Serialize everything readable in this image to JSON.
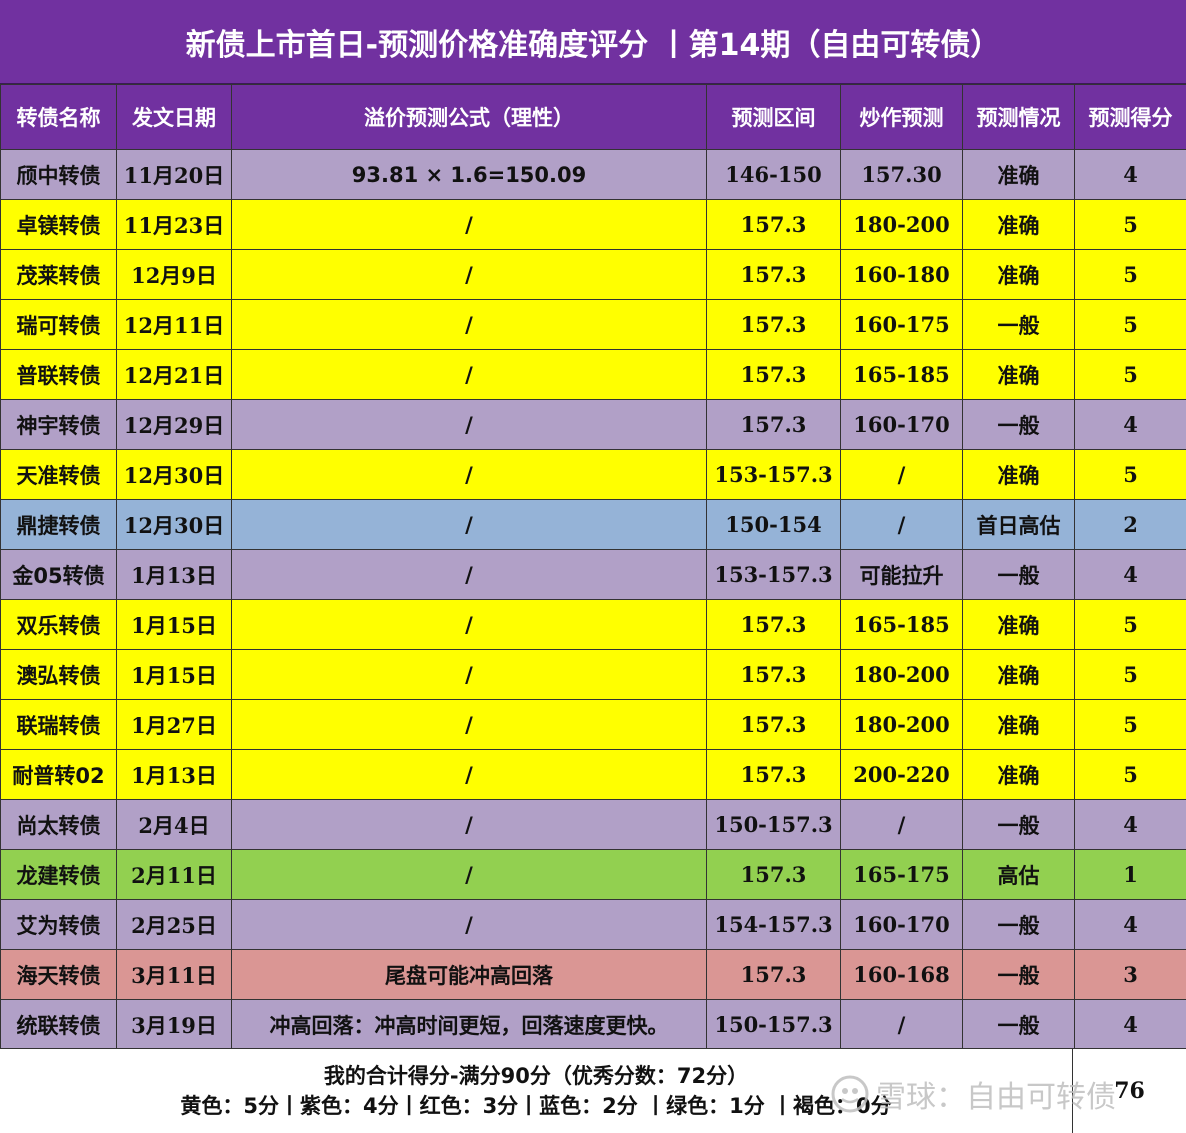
{
  "title": "新债上市首日-预测价格准确度评分 丨第14期（自由可转债）",
  "headers": [
    "转债名称",
    "发文日期",
    "溢价预测公式（理性）",
    "预测区间",
    "炒作预测",
    "预测情况",
    "预测得分"
  ],
  "colors": {
    "header_purple": "#7131a0",
    "yellow": "#ffff00",
    "purple": "#b1a0c7",
    "blue": "#95b3d7",
    "green": "#92d050",
    "red": "#da9694"
  },
  "rows": [
    {
      "name": "颀中转债",
      "date": "11月20日",
      "formula": "93.81 × 1.6=150.09",
      "range": "146-150",
      "hype": "157.30",
      "state": "准确",
      "score": "4",
      "color": "purple"
    },
    {
      "name": "卓镁转债",
      "date": "11月23日",
      "formula": "/",
      "range": "157.3",
      "hype": "180-200",
      "state": "准确",
      "score": "5",
      "color": "yellow"
    },
    {
      "name": "茂莱转债",
      "date": "12月9日",
      "formula": "/",
      "range": "157.3",
      "hype": "160-180",
      "state": "准确",
      "score": "5",
      "color": "yellow"
    },
    {
      "name": "瑞可转债",
      "date": "12月11日",
      "formula": "/",
      "range": "157.3",
      "hype": "160-175",
      "state": "一般",
      "score": "5",
      "color": "yellow"
    },
    {
      "name": "普联转债",
      "date": "12月21日",
      "formula": "/",
      "range": "157.3",
      "hype": "165-185",
      "state": "准确",
      "score": "5",
      "color": "yellow"
    },
    {
      "name": "神宇转债",
      "date": "12月29日",
      "formula": "/",
      "range": "157.3",
      "hype": "160-170",
      "state": "一般",
      "score": "4",
      "color": "purple"
    },
    {
      "name": "天准转债",
      "date": "12月30日",
      "formula": "/",
      "range": "153-157.3",
      "hype": "/",
      "state": "准确",
      "score": "5",
      "color": "yellow"
    },
    {
      "name": "鼎捷转债",
      "date": "12月30日",
      "formula": "/",
      "range": "150-154",
      "hype": "/",
      "state": "首日高估",
      "score": "2",
      "color": "blue"
    },
    {
      "name": "金05转债",
      "date": "1月13日",
      "formula": "/",
      "range": "153-157.3",
      "hype": "可能拉升",
      "state": "一般",
      "score": "4",
      "color": "purple"
    },
    {
      "name": "双乐转债",
      "date": "1月15日",
      "formula": "/",
      "range": "157.3",
      "hype": "165-185",
      "state": "准确",
      "score": "5",
      "color": "yellow"
    },
    {
      "name": "澳弘转债",
      "date": "1月15日",
      "formula": "/",
      "range": "157.3",
      "hype": "180-200",
      "state": "准确",
      "score": "5",
      "color": "yellow"
    },
    {
      "name": "联瑞转债",
      "date": "1月27日",
      "formula": "/",
      "range": "157.3",
      "hype": "180-200",
      "state": "准确",
      "score": "5",
      "color": "yellow"
    },
    {
      "name": "耐普转02",
      "date": "1月13日",
      "formula": "/",
      "range": "157.3",
      "hype": "200-220",
      "state": "准确",
      "score": "5",
      "color": "yellow"
    },
    {
      "name": "尚太转债",
      "date": "2月4日",
      "formula": "/",
      "range": "150-157.3",
      "hype": "/",
      "state": "一般",
      "score": "4",
      "color": "purple"
    },
    {
      "name": "龙建转债",
      "date": "2月11日",
      "formula": "/",
      "range": "157.3",
      "hype": "165-175",
      "state": "高估",
      "score": "1",
      "color": "green"
    },
    {
      "name": "艾为转债",
      "date": "2月25日",
      "formula": "/",
      "range": "154-157.3",
      "hype": "160-170",
      "state": "一般",
      "score": "4",
      "color": "purple"
    },
    {
      "name": "海天转债",
      "date": "3月11日",
      "formula": "尾盘可能冲高回落",
      "range": "157.3",
      "hype": "160-168",
      "state": "一般",
      "score": "3",
      "color": "red"
    },
    {
      "name": "统联转债",
      "date": "3月19日",
      "formula": "冲高回落：冲高时间更短，回落速度更快。",
      "range": "150-157.3",
      "hype": "/",
      "state": "一般",
      "score": "4",
      "color": "purple"
    }
  ],
  "footer": {
    "line1": "我的合计得分-满分90分（优秀分数：72分）",
    "line2": "黄色：5分丨紫色：4分丨红色：3分丨蓝色：2分 丨绿色：1分 丨褐色：0分",
    "total": "76"
  },
  "watermark": {
    "text": "雪球：自由可转债",
    "icon": "snowball-logo-icon"
  }
}
